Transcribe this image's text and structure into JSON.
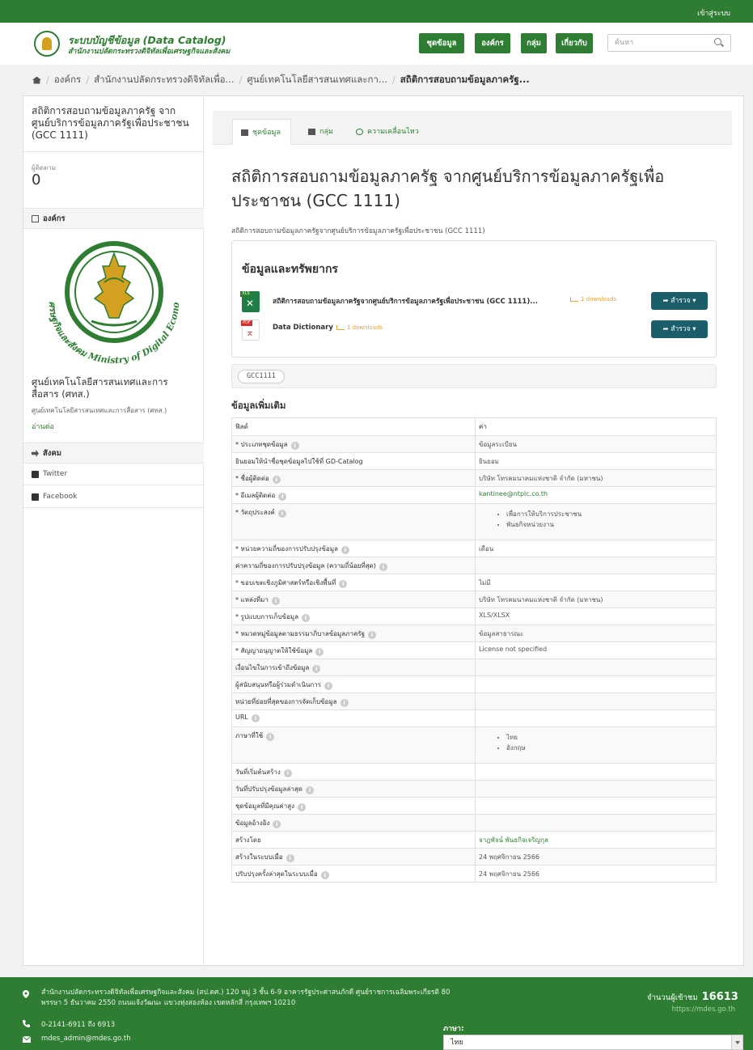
{
  "topbar": {
    "login": "เข้าสู่ระบบ"
  },
  "header": {
    "brand_title": "ระบบบัญชีข้อมูล (Data Catalog)",
    "brand_subtitle": "สำนักงานปลัดกระทรวงดิจิทัลเพื่อเศรษฐกิจและสังคม",
    "nav": [
      "ชุดข้อมูล",
      "องค์กร",
      "กลุ่ม",
      "เกี่ยวกับ"
    ],
    "search_placeholder": "ค้นหา",
    "brand_color": "#2e7d32"
  },
  "breadcrumb": [
    "องค์กร",
    "สำนักงานปลัดกระทรวงดิจิทัลเพื่อ...",
    "ศูนย์เทคโนโลยีสารสนเทศและกา...",
    "สถิติการสอบถามข้อมูลภาครัฐ..."
  ],
  "sidebar": {
    "dataset_title": "สถิติการสอบถามข้อมูลภาครัฐ จากศูนย์บริการข้อมูลภาครัฐเพื่อประชาชน (GCC 1111)",
    "followers_label": "ผู้ติดตาม",
    "followers_value": "0",
    "org_heading": "องค์กร",
    "org_logo_text": "กระทรวงดิจิทัลเพื่อเศรษฐกิจและสังคม Ministry of Digital Economy and Society",
    "org_name": "ศูนย์เทคโนโลยีสารสนเทศและการสื่อสาร (ศทส.)",
    "org_desc": "ศูนย์เทคโนโลยีสารสนเทศและการสื่อสาร (ศทส.)",
    "read_more": "อ่านต่อ",
    "social_heading": "สังคม",
    "social": [
      "Twitter",
      "Facebook"
    ]
  },
  "tabs": [
    "ชุดข้อมูล",
    "กลุ่ม",
    "ความเคลื่อนไหว"
  ],
  "dataset": {
    "title": "สถิติการสอบถามข้อมูลภาครัฐ จากศูนย์บริการข้อมูลภาครัฐเพื่อประชาชน (GCC 1111)",
    "description": "สถิติการสอบถามข้อมูลภาครัฐจากศูนย์บริการข้อมูลภาครัฐเพื่อประชาชน (GCC 1111)"
  },
  "resources": {
    "heading": "ข้อมูลและทรัพยากร",
    "explore_label": "สำรวจ",
    "items": [
      {
        "format": "XLS",
        "name": "สถิติการสอบถามข้อมูลภาครัฐจากศูนย์บริการข้อมูลภาครัฐเพื่อประชาชน (GCC 1111)...",
        "downloads": "1 downloads"
      },
      {
        "format": "PDF",
        "name": "Data Dictionary",
        "downloads": "1 downloads"
      }
    ]
  },
  "tags": [
    "GCC1111"
  ],
  "additional_info": {
    "heading": "ข้อมูลเพิ่มเติม",
    "col_field": "ฟิลด์",
    "col_value": "ค่า",
    "rows": [
      {
        "field": "* ประเภทชุดข้อมูล",
        "value": "ข้อมูลระเบียน"
      },
      {
        "field": "ยินยอมให้นำชื่อชุดข้อมูลไปใช้ที่ GD-Catalog",
        "value": "ยินยอม"
      },
      {
        "field": "* ชื่อผู้ติดต่อ",
        "value": "บริษัท โทรคมนาคมแห่งชาติ จำกัด (มหาชน)"
      },
      {
        "field": "* อีเมลผู้ติดต่อ",
        "value": "kantinee@ntplc.co.th"
      },
      {
        "field": "* วัตถุประสงค์",
        "items": [
          "เพื่อการให้บริการประชาชน",
          "พันธกิจหน่วยงาน"
        ]
      },
      {
        "field": "* หน่วยความถี่ของการปรับปรุงข้อมูล",
        "value": "เดือน"
      },
      {
        "field": "ค่าความถี่ของการปรับปรุงข้อมูล (ความถี่น้อยที่สุด)",
        "value": ""
      },
      {
        "field": "* ขอบเขตเชิงภูมิศาสตร์หรือเชิงพื้นที่",
        "value": "ไม่มี"
      },
      {
        "field": "* แหล่งที่มา",
        "value": "บริษัท โทรคมนาคมแห่งชาติ จำกัด (มหาชน)"
      },
      {
        "field": "* รูปแบบการเก็บข้อมูล",
        "value": "XLS/XLSX"
      },
      {
        "field": "* หมวดหมู่ข้อมูลตามธรรมาภิบาลข้อมูลภาครัฐ",
        "value": "ข้อมูลสาธารณะ"
      },
      {
        "field": "* สัญญาอนุญาตให้ใช้ข้อมูล",
        "value": "License not specified"
      },
      {
        "field": "เงื่อนไขในการเข้าถึงข้อมูล",
        "value": ""
      },
      {
        "field": "ผู้สนับสนุนหรือผู้ร่วมดำเนินการ",
        "value": ""
      },
      {
        "field": "หน่วยที่ย่อยที่สุดของการจัดเก็บข้อมูล",
        "value": ""
      },
      {
        "field": "URL",
        "value": ""
      },
      {
        "field": "ภาษาที่ใช้",
        "items": [
          "ไทย",
          "อังกฤษ"
        ]
      },
      {
        "field": "วันที่เริ่มต้นสร้าง",
        "value": ""
      },
      {
        "field": "วันที่ปรับปรุงข้อมูลล่าสุด",
        "value": ""
      },
      {
        "field": "ชุดข้อมูลที่มีคุณค่าสูง",
        "value": ""
      },
      {
        "field": "ข้อมูลอ้างอิง",
        "value": ""
      },
      {
        "field": "สร้างโดย",
        "value": "จาฎพัจน์ พันธกิจเจริญกุล"
      },
      {
        "field": "สร้างในระบบเมื่อ",
        "value": "24 พฤศจิกายน 2566"
      },
      {
        "field": "ปรับปรุงครั้งล่าสุดในระบบเมื่อ",
        "value": "24 พฤศจิกายน 2566"
      }
    ]
  },
  "footer": {
    "address": "สำนักงานปลัดกระทรวงดิจิทัลเพื่อเศรษฐกิจและสังคม (สป.ดศ.) 120 หมู่ 3 ชั้น 6-9 อาคารรัฐประศาสนภักดี ศูนย์ราชการเฉลิมพระเกียรติ 80 พรรษา 5 ธันวาคม 2550 ถนนแจ้งวัฒนะ แขวงทุ่งสองห้อง เขตหลักสี่ กรุงเทพฯ 10210",
    "phone": "0-2141-6911 ถึง 6913",
    "email": "mdes_admin@mdes.go.th",
    "visitors_label": "จำนวนผู้เข้าชม",
    "visitors_count": "16613",
    "url": "https://mdes.go.th",
    "language_label": "ภาษา:",
    "language_value": "ไทย"
  }
}
